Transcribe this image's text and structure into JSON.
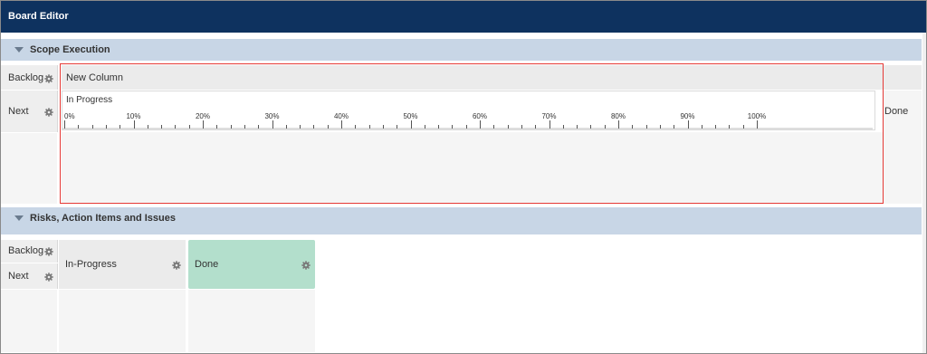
{
  "window": {
    "title": "Board Editor"
  },
  "sections": [
    {
      "label": "Scope Execution"
    },
    {
      "label": "Risks, Action Items and Issues"
    }
  ],
  "scope": {
    "lanes": [
      "Backlog",
      "Next"
    ],
    "new_column": "New Column",
    "in_progress": "In Progress",
    "done": "Done",
    "ruler": {
      "labels": [
        "0%",
        "10%",
        "20%",
        "30%",
        "40%",
        "50%",
        "60%",
        "70%",
        "80%",
        "90%",
        "100%"
      ],
      "min": 0,
      "max": 100,
      "minor_step": 2
    }
  },
  "risks": {
    "lanes": [
      "Backlog",
      "Next"
    ],
    "columns": [
      {
        "label": "In-Progress",
        "color": "#ebebeb"
      },
      {
        "label": "Done",
        "color": "#b3dfcc"
      }
    ]
  },
  "colors": {
    "titlebar": "#0e325f",
    "section": "#c8d6e6",
    "highlight": "#e53935",
    "done": "#b3dfcc"
  },
  "icons": {
    "gear": "gear-icon",
    "chevron": "chevron-down-icon"
  }
}
